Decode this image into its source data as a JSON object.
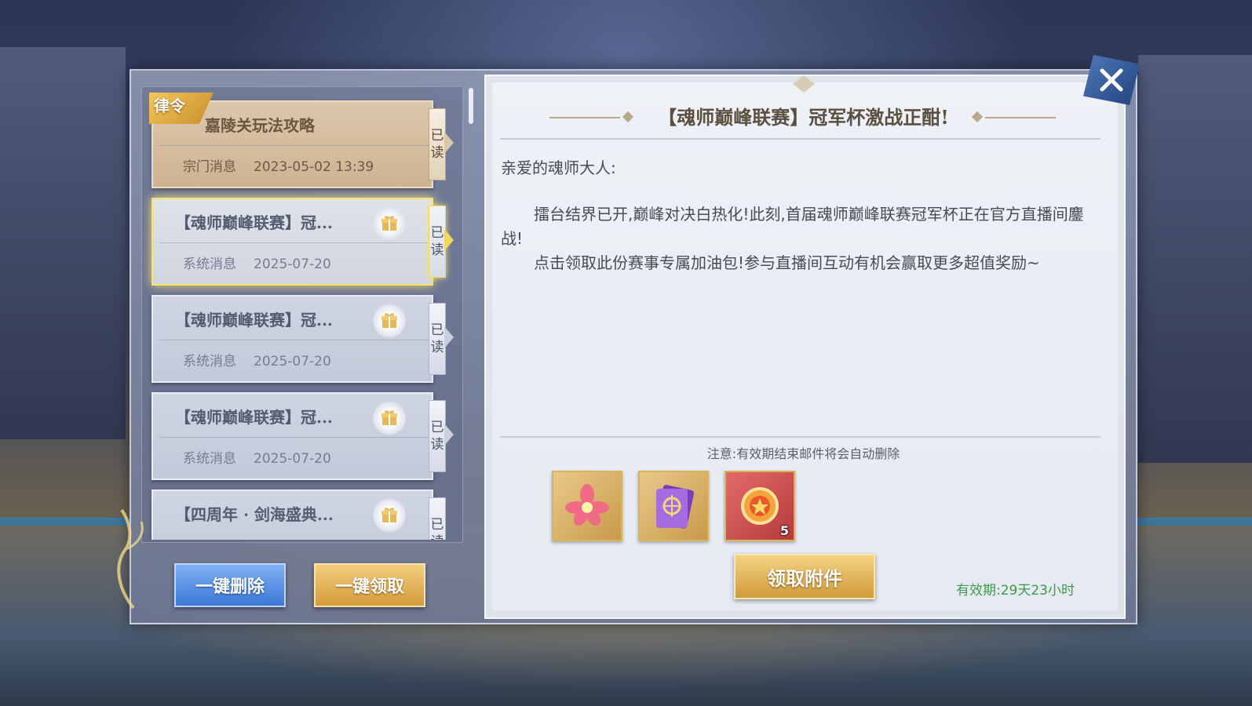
{
  "mail_list": [
    {
      "title": "嘉陵关玩法攻略",
      "category": "宗门消息",
      "date": "2023-05-02 13:39",
      "status": "已读",
      "badge": "律令",
      "has_gift": false
    },
    {
      "title": "【魂师巅峰联赛】冠...",
      "category": "系统消息",
      "date": "2025-07-20",
      "status": "已读",
      "has_gift": true,
      "selected": true
    },
    {
      "title": "【魂师巅峰联赛】冠...",
      "category": "系统消息",
      "date": "2025-07-20",
      "status": "已读",
      "has_gift": true
    },
    {
      "title": "【魂师巅峰联赛】冠...",
      "category": "系统消息",
      "date": "2025-07-20",
      "status": "已读",
      "has_gift": true
    },
    {
      "title": "【四周年 · 剑海盛典...",
      "status": "已读",
      "has_gift": true
    }
  ],
  "buttons": {
    "delete_all": "一键删除",
    "claim_all": "一键领取",
    "claim_attachment": "领取附件"
  },
  "detail": {
    "title": "【魂师巅峰联赛】冠军杯激战正酣!",
    "greeting": "亲爱的魂师大人:",
    "paragraphs": [
      "擂台结界已开,巅峰对决白热化!此刻,首届魂师巅峰联赛冠军杯正在官方直播间鏖战!",
      "点击领取此份赛事专属加油包!参与直播间互动有机会赢取更多超值奖励~"
    ],
    "note": "注意:有效期结束邮件将会自动删除",
    "attachments": [
      {
        "icon": "pink-flower-icon",
        "count": null
      },
      {
        "icon": "purple-card-icon",
        "count": null
      },
      {
        "icon": "gold-medal-icon",
        "count": "5"
      }
    ],
    "validity": "有效期:29天23小时"
  },
  "colors": {
    "gold_accent": "#d39b3a",
    "blue_button": "#3c78d6",
    "validity_green": "#3d9a4d",
    "selection_glow": "#f5e36a"
  }
}
